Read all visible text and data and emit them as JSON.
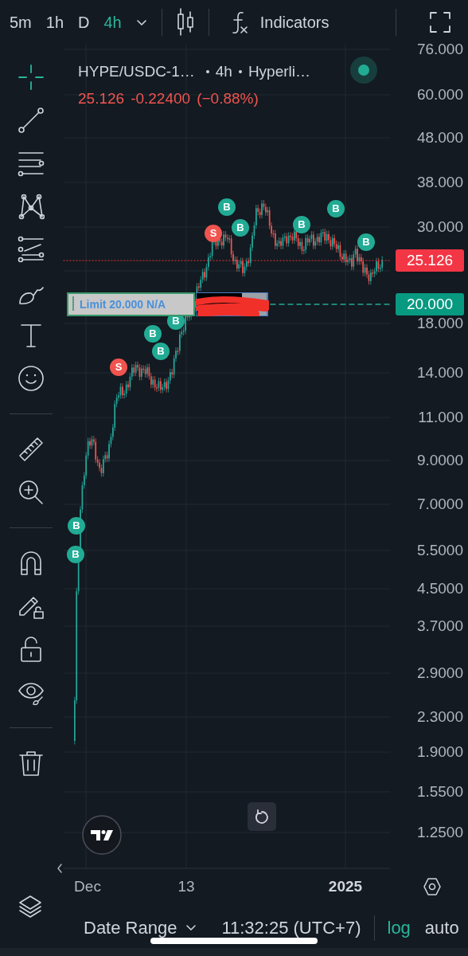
{
  "toolbar": {
    "intervals": [
      {
        "label": "5m",
        "selected": false
      },
      {
        "label": "1h",
        "selected": false
      },
      {
        "label": "D",
        "selected": false
      },
      {
        "label": "4h",
        "selected": true
      }
    ],
    "indicators": "Indicators"
  },
  "tools": [
    {
      "kind": "crosshair",
      "selected": true
    },
    {
      "kind": "trendline",
      "selected": false
    },
    {
      "kind": "fib",
      "selected": false
    },
    {
      "kind": "pattern",
      "selected": false
    },
    {
      "kind": "projection",
      "selected": false
    },
    {
      "kind": "brush",
      "selected": false
    },
    {
      "kind": "text",
      "selected": false
    },
    {
      "kind": "emoji",
      "selected": false
    },
    {
      "kind": "divider"
    },
    {
      "kind": "ruler",
      "selected": false
    },
    {
      "kind": "zoom",
      "selected": false
    },
    {
      "kind": "divider"
    },
    {
      "kind": "magnet",
      "selected": false
    },
    {
      "kind": "drawmode",
      "selected": false
    },
    {
      "kind": "lock",
      "selected": false
    },
    {
      "kind": "visibility",
      "selected": false
    },
    {
      "kind": "divider"
    },
    {
      "kind": "trash",
      "selected": false
    }
  ],
  "legend": {
    "symbol": "HYPE/USDC-1…",
    "interval": "4h",
    "exchange": "Hyperli…",
    "price": "25.126",
    "change": "-0.22400",
    "change_percent": "(−0.88%)"
  },
  "price_axis": {
    "labels": [
      "76.000",
      "60.000",
      "48.000",
      "38.000",
      "30.000",
      "18.000",
      "14.000",
      "11.000",
      "9.0000",
      "7.0000",
      "5.5000",
      "4.5000",
      "3.7000",
      "2.9000",
      "2.3000",
      "1.9000",
      "1.5500",
      "1.2500"
    ],
    "last_price": "25.126",
    "order_price": "20.000"
  },
  "order": {
    "label": "Limit 20.000 N/A"
  },
  "markers": [
    {
      "kind": "buy",
      "label": "B"
    },
    {
      "kind": "sell",
      "label": "S"
    },
    {
      "kind": "buy",
      "label": "B"
    },
    {
      "kind": "buy",
      "label": "B"
    },
    {
      "kind": "buy",
      "label": "B"
    },
    {
      "kind": "buy",
      "label": "B"
    },
    {
      "kind": "buy",
      "label": "B"
    },
    {
      "kind": "buy",
      "label": "B"
    },
    {
      "kind": "buy",
      "label": "B"
    },
    {
      "kind": "sell",
      "label": "S"
    },
    {
      "kind": "buy",
      "label": "B"
    },
    {
      "kind": "buy",
      "label": "B"
    }
  ],
  "time_axis": [
    {
      "label": "Dec",
      "bold": false
    },
    {
      "label": "13",
      "bold": false
    },
    {
      "label": "2025",
      "bold": true
    }
  ],
  "status_bar": {
    "date_range": "Date Range",
    "time": "11:32:25 (UTC+7)",
    "scales": [
      {
        "label": "log",
        "selected": true
      },
      {
        "label": "auto",
        "selected": false
      }
    ]
  }
}
